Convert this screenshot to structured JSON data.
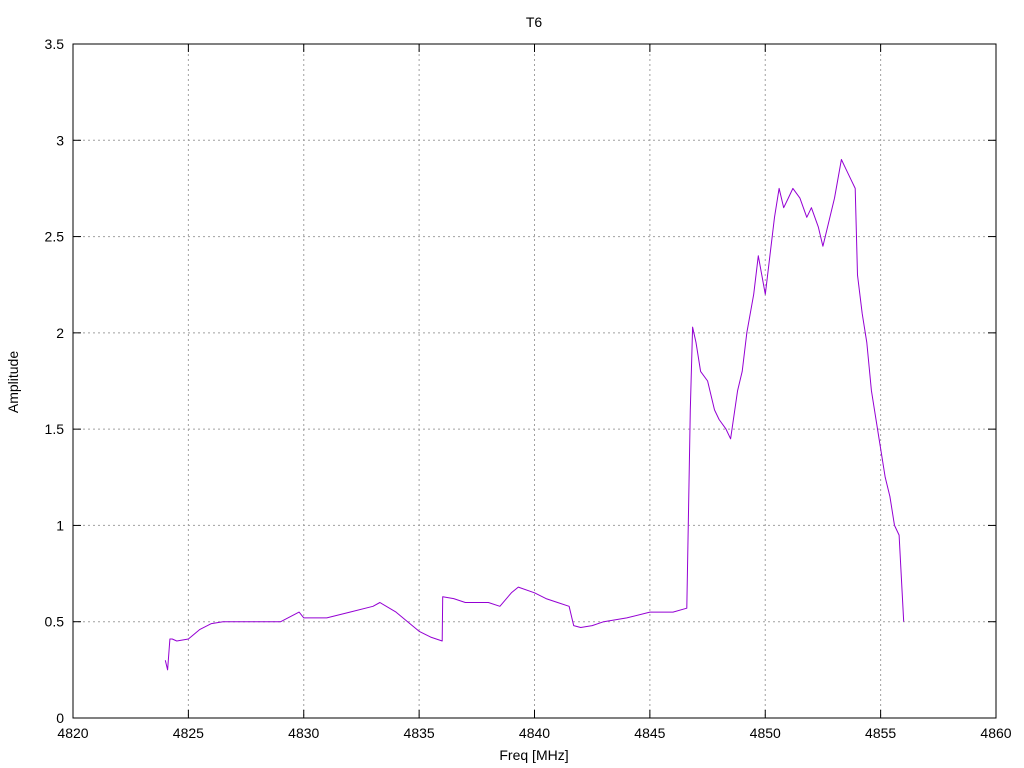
{
  "chart_data": {
    "type": "line",
    "title": "T6",
    "xlabel": "Freq [MHz]",
    "ylabel": "Amplitude",
    "xlim": [
      4820,
      4860
    ],
    "ylim": [
      0,
      3.5
    ],
    "x_ticks": [
      4820,
      4825,
      4830,
      4835,
      4840,
      4845,
      4850,
      4855,
      4860
    ],
    "x_tick_labels": [
      "4820",
      "4825",
      "4830",
      "4835",
      "4840",
      "4845",
      "4850",
      "4855",
      "4860"
    ],
    "y_ticks": [
      0,
      0.5,
      1,
      1.5,
      2,
      2.5,
      3,
      3.5
    ],
    "y_tick_labels": [
      "0",
      "0.5",
      "1",
      "1.5",
      "2",
      "2.5",
      "3",
      "3.5"
    ],
    "grid": true,
    "legend": "none",
    "series": [
      {
        "color": "#9400d3",
        "x": [
          4824.0,
          4824.1,
          4824.2,
          4824.3,
          4824.5,
          4825.0,
          4825.5,
          4826.0,
          4826.5,
          4827.0,
          4828.0,
          4829.0,
          4829.8,
          4830.0,
          4831.0,
          4832.0,
          4833.0,
          4833.3,
          4834.0,
          4834.5,
          4835.0,
          4835.5,
          4836.0,
          4836.02,
          4836.5,
          4837.0,
          4838.0,
          4838.5,
          4839.0,
          4839.3,
          4840.0,
          4840.5,
          4841.0,
          4841.5,
          4841.7,
          4842.0,
          4842.5,
          4843.0,
          4844.0,
          4845.0,
          4846.0,
          4846.6,
          4846.75,
          4846.85,
          4847.0,
          4847.2,
          4847.5,
          4847.8,
          4848.0,
          4848.3,
          4848.5,
          4848.8,
          4849.0,
          4849.2,
          4849.5,
          4849.7,
          4850.0,
          4850.2,
          4850.4,
          4850.6,
          4850.8,
          4851.0,
          4851.2,
          4851.5,
          4851.8,
          4852.0,
          4852.3,
          4852.5,
          4852.8,
          4853.0,
          4853.3,
          4853.5,
          4853.7,
          4853.9,
          4854.0,
          4854.2,
          4854.4,
          4854.6,
          4854.8,
          4855.0,
          4855.2,
          4855.4,
          4855.6,
          4855.8,
          4856.0
        ],
        "y": [
          0.3,
          0.25,
          0.41,
          0.41,
          0.4,
          0.41,
          0.46,
          0.49,
          0.5,
          0.5,
          0.5,
          0.5,
          0.55,
          0.52,
          0.52,
          0.55,
          0.58,
          0.6,
          0.55,
          0.5,
          0.45,
          0.42,
          0.4,
          0.63,
          0.62,
          0.6,
          0.6,
          0.58,
          0.65,
          0.68,
          0.65,
          0.62,
          0.6,
          0.58,
          0.48,
          0.47,
          0.48,
          0.5,
          0.52,
          0.55,
          0.55,
          0.57,
          1.6,
          2.03,
          1.95,
          1.8,
          1.75,
          1.6,
          1.55,
          1.5,
          1.45,
          1.7,
          1.8,
          2.0,
          2.2,
          2.4,
          2.2,
          2.4,
          2.6,
          2.75,
          2.65,
          2.7,
          2.75,
          2.7,
          2.6,
          2.65,
          2.55,
          2.45,
          2.6,
          2.7,
          2.9,
          2.85,
          2.8,
          2.75,
          2.3,
          2.1,
          1.95,
          1.7,
          1.55,
          1.4,
          1.25,
          1.15,
          1.0,
          0.95,
          0.5
        ]
      }
    ]
  }
}
